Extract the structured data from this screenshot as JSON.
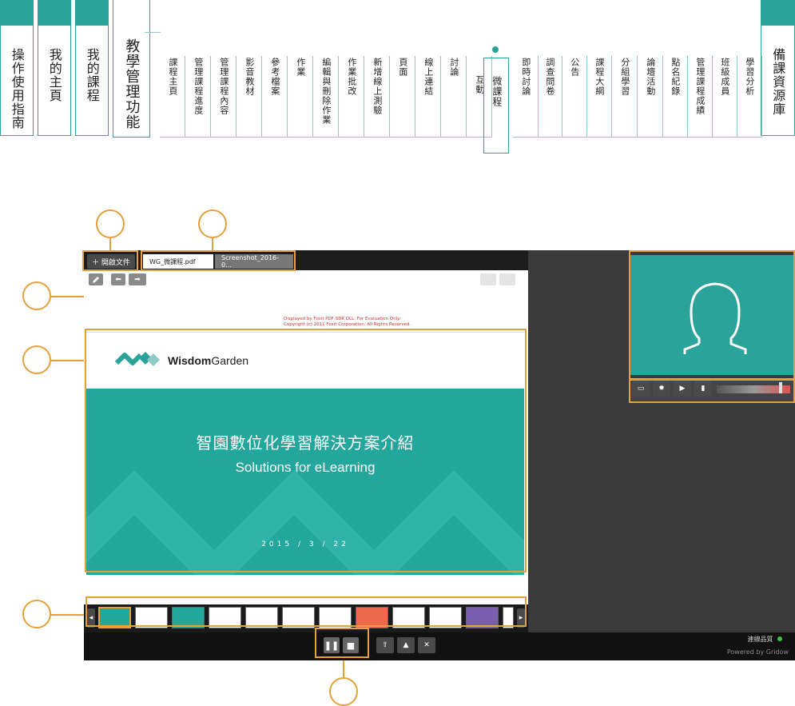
{
  "nav": {
    "big_tabs": [
      "操作使用指南",
      "我的主頁",
      "我的課程",
      "教學管理功能",
      "備課資源庫"
    ],
    "small_tabs": [
      "課程主頁",
      "管理課程進度",
      "管理課程內容",
      "影音教材",
      "參考檔案",
      "作業",
      "編輯與刪除作業",
      "作業批改",
      "新增線上測驗",
      "頁面",
      "線上連結",
      "討論",
      "互動",
      "微課程",
      "即時討論",
      "調查問卷",
      "公告",
      "課程大綱",
      "分組學習",
      "論壇活動",
      "點名紀錄",
      "管理課程成績",
      "班級成員",
      "學習分析"
    ]
  },
  "player": {
    "open_doc_label": "＋ 開啟文件",
    "doc_tabs": [
      "WG_微課程.pdf",
      "Screenshot_2016-0..."
    ],
    "watermark_line1": "Displayed by Foxit PDF SDK DLL. For Evaluation Only.",
    "watermark_line2": "Copyright (c) 2011 Foxit Corporation. All Rights Reserved.",
    "brand_name_bold": "Wisdom",
    "brand_name_rest": "Garden",
    "slide_title": "智園數位化學習解決方案介紹",
    "slide_subtitle": "Solutions for eLearning",
    "slide_date": "2015 / 3 / 22",
    "status_text": "連線品質",
    "powered_by": "Powered by Gridow"
  },
  "colors": {
    "accent": "#2aa39b",
    "callout": "#e8a03c",
    "slide_teal": "#23a69b"
  }
}
